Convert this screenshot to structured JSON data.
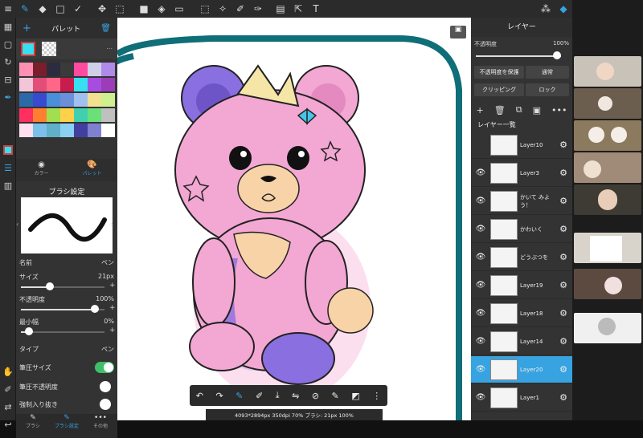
{
  "palette_panel": {
    "title": "パレット",
    "tab_color": "カラー",
    "tab_palette": "パレット",
    "more": "..."
  },
  "brush_panel": {
    "title": "ブラシ設定",
    "name_label": "名前",
    "name_value": "ペン",
    "size_label": "サイズ",
    "size_value": "21px",
    "opacity_label": "不透明度",
    "opacity_value": "100%",
    "minwidth_label": "最小幅",
    "minwidth_value": "0%",
    "type_label": "タイプ",
    "type_value": "ペン",
    "pressure_size_label": "筆圧サイズ",
    "pressure_opacity_label": "筆圧不透明度",
    "force_stroke_label": "強制入り抜き",
    "size_slider": 0.35,
    "opacity_slider": 0.88,
    "minwidth_slider": 0.1
  },
  "bottom_tabs": [
    {
      "label": "ブラシ"
    },
    {
      "label": "ブラシ設定"
    },
    {
      "label": "その他"
    }
  ],
  "canvas_status": "4093*2894px 350dpi 70% ブラシ: 21px 100%",
  "layers_panel": {
    "title": "レイヤー",
    "opacity_label": "不透明度",
    "opacity_value": "100%",
    "protect_label": "不透明度を保護",
    "blend_label": "通常",
    "clipping_label": "クリッピング",
    "lock_label": "ロック",
    "list_label": "レイヤー一覧",
    "layers": [
      {
        "name": "Layer10"
      },
      {
        "name": "Layer3"
      },
      {
        "name": "かいて みよう！"
      },
      {
        "name": "かわいく"
      },
      {
        "name": "どうぶつを"
      },
      {
        "name": "Layer19"
      },
      {
        "name": "Layer18"
      },
      {
        "name": "Layer14"
      },
      {
        "name": "Layer20"
      },
      {
        "name": "Layer1"
      }
    ],
    "selected_layer": "Layer20"
  },
  "colors": {
    "accent": "#37a3e0",
    "toggle_on": "#3ec06a",
    "teal_frame": "#0f6e78",
    "bear_pink": "#f3a7d3",
    "bear_purple": "#8a6fe0"
  },
  "palette_colors": [
    [
      "#ff8fb3",
      "#7a1e2c",
      "#2c2c40",
      "#3a3a3a",
      "#ff4aa0",
      "#cfcfe8",
      "#b08ae8"
    ],
    [
      "#f2c6d8",
      "#e44c7a",
      "#ff6688",
      "#c71c4c",
      "#36e0f0",
      "#a64de0",
      "#9c3cb8"
    ],
    [
      "#2a6aa8",
      "#3a4ad0",
      "#4a90d8",
      "#6b8fd8",
      "#a0c0f0",
      "#f0e090",
      "#d0f090"
    ],
    [
      "#ff2f60",
      "#ff7f30",
      "#a0e050",
      "#ffd04a",
      "#40d0b0",
      "#6ae07a",
      "#c0c0c0"
    ],
    [
      "#ffe0f0",
      "#7ac0e8",
      "#60b0c8",
      "#8ad0f0",
      "#4040a0",
      "#8080d0",
      "#ffffff"
    ]
  ]
}
